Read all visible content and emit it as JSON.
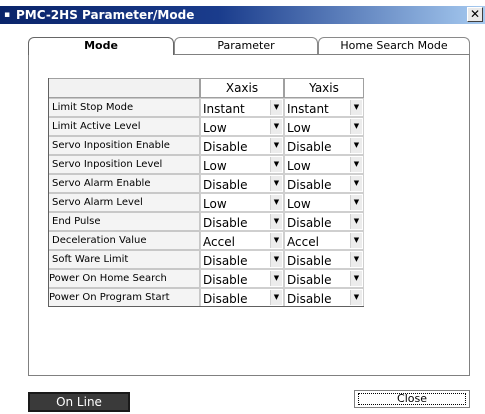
{
  "window": {
    "title": "PMC-2HS Parameter/Mode",
    "close_glyph": "✕",
    "app_icon": "app-icon"
  },
  "tabs": [
    {
      "label": "Mode",
      "active": true
    },
    {
      "label": "Parameter",
      "active": false
    },
    {
      "label": "Home Search Mode",
      "active": false
    }
  ],
  "grid": {
    "columns": [
      "Xaxis",
      "Yaxis"
    ],
    "rows": [
      {
        "label": "Limit Stop Mode",
        "x": "Instant",
        "y": "Instant"
      },
      {
        "label": "Limit Active Level",
        "x": "Low",
        "y": "Low"
      },
      {
        "label": "Servo Inposition Enable",
        "x": "Disable",
        "y": "Disable"
      },
      {
        "label": "Servo Inposition Level",
        "x": "Low",
        "y": "Low"
      },
      {
        "label": "Servo Alarm Enable",
        "x": "Disable",
        "y": "Disable"
      },
      {
        "label": "Servo Alarm Level",
        "x": "Low",
        "y": "Low"
      },
      {
        "label": "End Pulse",
        "x": "Disable",
        "y": "Disable"
      },
      {
        "label": "Deceleration Value",
        "x": "Accel",
        "y": "Accel"
      },
      {
        "label": "Soft Ware Limit",
        "x": "Disable",
        "y": "Disable"
      },
      {
        "label": "Power On Home Search",
        "x": "Disable",
        "y": "Disable"
      },
      {
        "label": "Power On Program Start",
        "x": "Disable",
        "y": "Disable"
      }
    ]
  },
  "status": {
    "online_label": "On Line"
  },
  "footer": {
    "close_label": "Close"
  },
  "icons": {
    "dropdown": "▼"
  },
  "colors": {
    "titlebar": "#0a246a",
    "online_bg": "#3a3a3a"
  }
}
